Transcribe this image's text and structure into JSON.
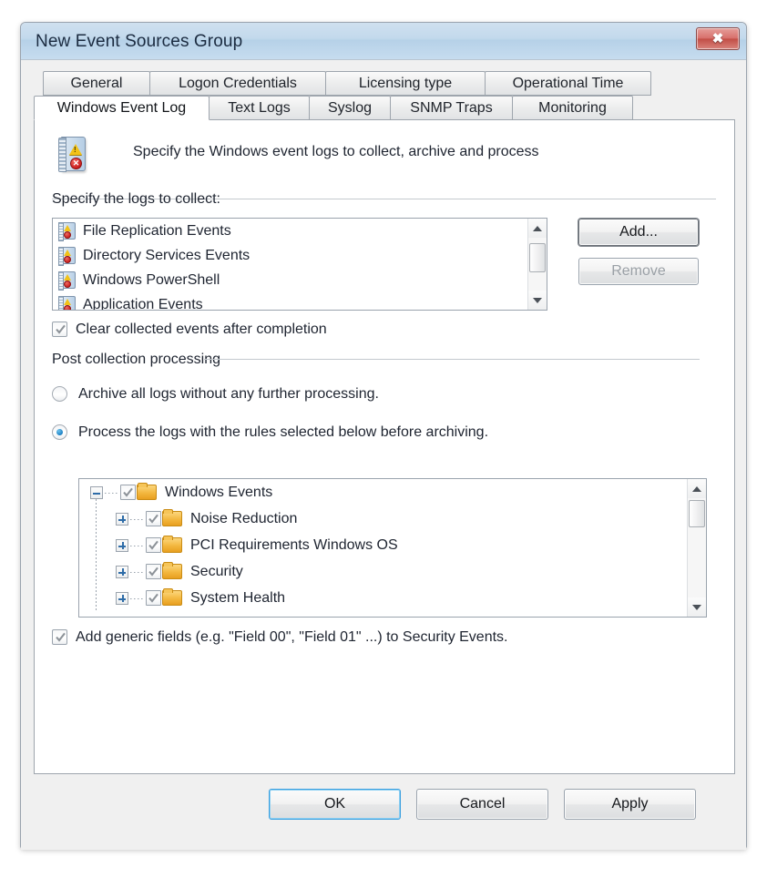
{
  "window": {
    "title": "New Event Sources Group",
    "close_label": "✖"
  },
  "tabs": {
    "row1": [
      {
        "label": "General",
        "selected": false
      },
      {
        "label": "Logon Credentials",
        "selected": false
      },
      {
        "label": "Licensing type",
        "selected": false
      },
      {
        "label": "Operational Time",
        "selected": false
      }
    ],
    "row2": [
      {
        "label": "Windows Event Log",
        "selected": true
      },
      {
        "label": "Text Logs",
        "selected": false
      },
      {
        "label": "Syslog",
        "selected": false
      },
      {
        "label": "SNMP Traps",
        "selected": false
      },
      {
        "label": "Monitoring",
        "selected": false
      }
    ]
  },
  "page": {
    "header_text": "Specify the Windows event logs to collect, archive and process",
    "header_icon": "event-log-book-icon",
    "logs_label": "Specify the logs to collect:",
    "log_items": [
      {
        "label": "File Replication Events",
        "icon": "event-log-icon"
      },
      {
        "label": "Directory Services Events",
        "icon": "event-log-icon"
      },
      {
        "label": "Windows PowerShell",
        "icon": "event-log-icon"
      },
      {
        "label": "Application Events",
        "icon": "event-log-icon"
      }
    ],
    "add_button": "Add...",
    "remove_button": "Remove",
    "clear_checkbox": {
      "label": "Clear collected events after completion",
      "checked": true
    },
    "post_collection_group": "Post collection processing",
    "radios": [
      {
        "label": "Archive all logs without any further processing.",
        "selected": false
      },
      {
        "label": "Process the logs with the rules selected below before archiving.",
        "selected": true
      }
    ],
    "tree": [
      {
        "label": "Windows Events",
        "depth": 0,
        "expander": "minus",
        "checked": true
      },
      {
        "label": "Noise Reduction",
        "depth": 1,
        "expander": "plus",
        "checked": true
      },
      {
        "label": "PCI Requirements Windows OS",
        "depth": 1,
        "expander": "plus",
        "checked": true
      },
      {
        "label": "Security",
        "depth": 1,
        "expander": "plus",
        "checked": true
      },
      {
        "label": "System Health",
        "depth": 1,
        "expander": "plus",
        "checked": true
      }
    ],
    "generic_fields_checkbox": {
      "label": "Add generic fields (e.g. \"Field 00\", \"Field 01\" ...) to Security Events.",
      "checked": true
    }
  },
  "footer": {
    "ok": "OK",
    "cancel": "Cancel",
    "apply": "Apply"
  },
  "colors": {
    "accent": "#1b80c4",
    "title_gradient_top": "#cfe0ef",
    "title_gradient_bottom": "#c6dcef",
    "close_red": "#c24e46",
    "folder_orange": "#f3b73f",
    "text": "#1e2430"
  }
}
